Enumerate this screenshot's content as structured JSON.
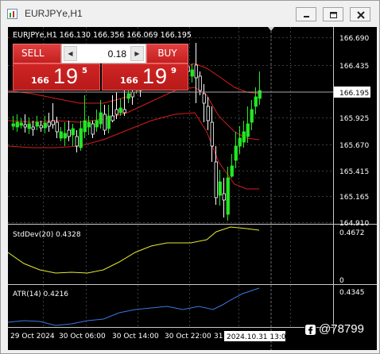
{
  "window": {
    "title": "EURJPYе,H1"
  },
  "chart": {
    "info_line": "EURJPYе,H1  166.130 166.356 166.069 166.195",
    "current_price": "166.195",
    "price_axis": [
      "166.690",
      "166.435",
      "165.925",
      "165.670",
      "165.415",
      "165.165",
      "164.910"
    ],
    "time_axis": [
      "29 Oct 2024",
      "30 Oct 06:00",
      "30 Oct 14:00",
      "30 Oct 22:00",
      "31 O"
    ],
    "crosshair_time": "2024.10.31 13:00",
    "colors": {
      "background": "#000000",
      "bull_candle": "#22e822",
      "bear_candle": "#ffffff",
      "bands": "#d81c1c",
      "stddev": "#e8e830",
      "atr": "#3a78e0",
      "grid": "#3c3c3c"
    }
  },
  "trade_panel": {
    "sell_label": "SELL",
    "buy_label": "BUY",
    "lot_value": "0.18",
    "sell_price": {
      "small": "166",
      "big": "19",
      "sup": "5"
    },
    "buy_price": {
      "small": "166",
      "big": "19",
      "sup": "9"
    }
  },
  "stddev_panel": {
    "label": "StdDev(20) 0.4328",
    "axis": [
      "0.4672",
      "0"
    ]
  },
  "atr_panel": {
    "label": "ATR(14) 0.4216",
    "axis": [
      "0.4345"
    ]
  },
  "watermark": {
    "text": "@78799"
  },
  "icons": {
    "app": "chart-app-icon",
    "minimize": "minimize-icon",
    "maximize": "maximize-icon",
    "close": "close-icon",
    "lot_down": "triangle-left-icon",
    "lot_up": "triangle-right-icon",
    "watermark": "social-logo-icon"
  }
}
